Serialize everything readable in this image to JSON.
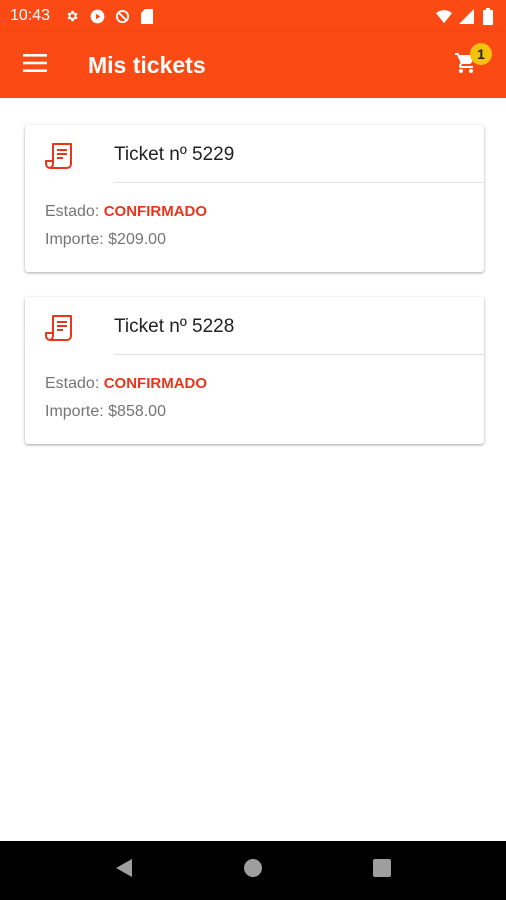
{
  "status_bar": {
    "time": "10:43",
    "icons": [
      "settings-icon",
      "play-icon",
      "no-sync-icon",
      "sd-card-icon",
      "wifi-icon",
      "signal-icon",
      "battery-icon"
    ]
  },
  "app_bar": {
    "title": "Mis tickets",
    "cart_count": "1",
    "color": "#fb4a13"
  },
  "tickets": [
    {
      "title": "Ticket nº 5229",
      "state_label": "Estado:",
      "state_value": "CONFIRMADO",
      "amount_label": "Importe:",
      "amount_value": "$209.00"
    },
    {
      "title": "Ticket nº 5228",
      "state_label": "Estado:",
      "state_value": "CONFIRMADO",
      "amount_label": "Importe:",
      "amount_value": "$858.00"
    }
  ],
  "colors": {
    "accent": "#fb4a13",
    "state": "#e8361c",
    "badge": "#f4c20d"
  }
}
